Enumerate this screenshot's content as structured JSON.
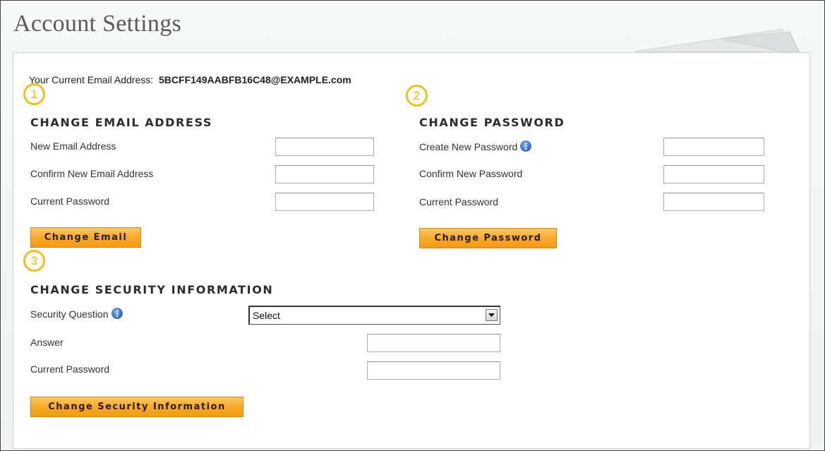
{
  "page": {
    "title": "Account Settings"
  },
  "current_email": {
    "label": "Your Current Email Address:",
    "value": "5BCFF149AABFB16C48@EXAMPLE.com"
  },
  "badges": [
    "1",
    "2",
    "3"
  ],
  "email_section": {
    "heading": "CHANGE EMAIL ADDRESS",
    "fields": {
      "new_email_label": "New Email Address",
      "confirm_email_label": "Confirm New Email Address",
      "current_password_label": "Current Password"
    },
    "button_label": "Change Email"
  },
  "password_section": {
    "heading": "CHANGE PASSWORD",
    "fields": {
      "create_password_label": "Create New Password",
      "confirm_password_label": "Confirm New Password",
      "current_password_label": "Current Password"
    },
    "button_label": "Change Password"
  },
  "security_section": {
    "heading": "CHANGE SECURITY INFORMATION",
    "fields": {
      "question_label": "Security Question",
      "question_selected": "Select",
      "answer_label": "Answer",
      "current_password_label": "Current Password"
    },
    "button_label": "Change Security Information"
  },
  "icons": {
    "info": "info-icon",
    "dropdown": "chevron-down-icon",
    "badge": "numbered-circle-icon"
  },
  "colors": {
    "button_top": "#fcc765",
    "button_bottom": "#f29a16",
    "badge": "#f2c01e",
    "info_icon": "#2e6fd1",
    "title": "#5a5a5a"
  }
}
